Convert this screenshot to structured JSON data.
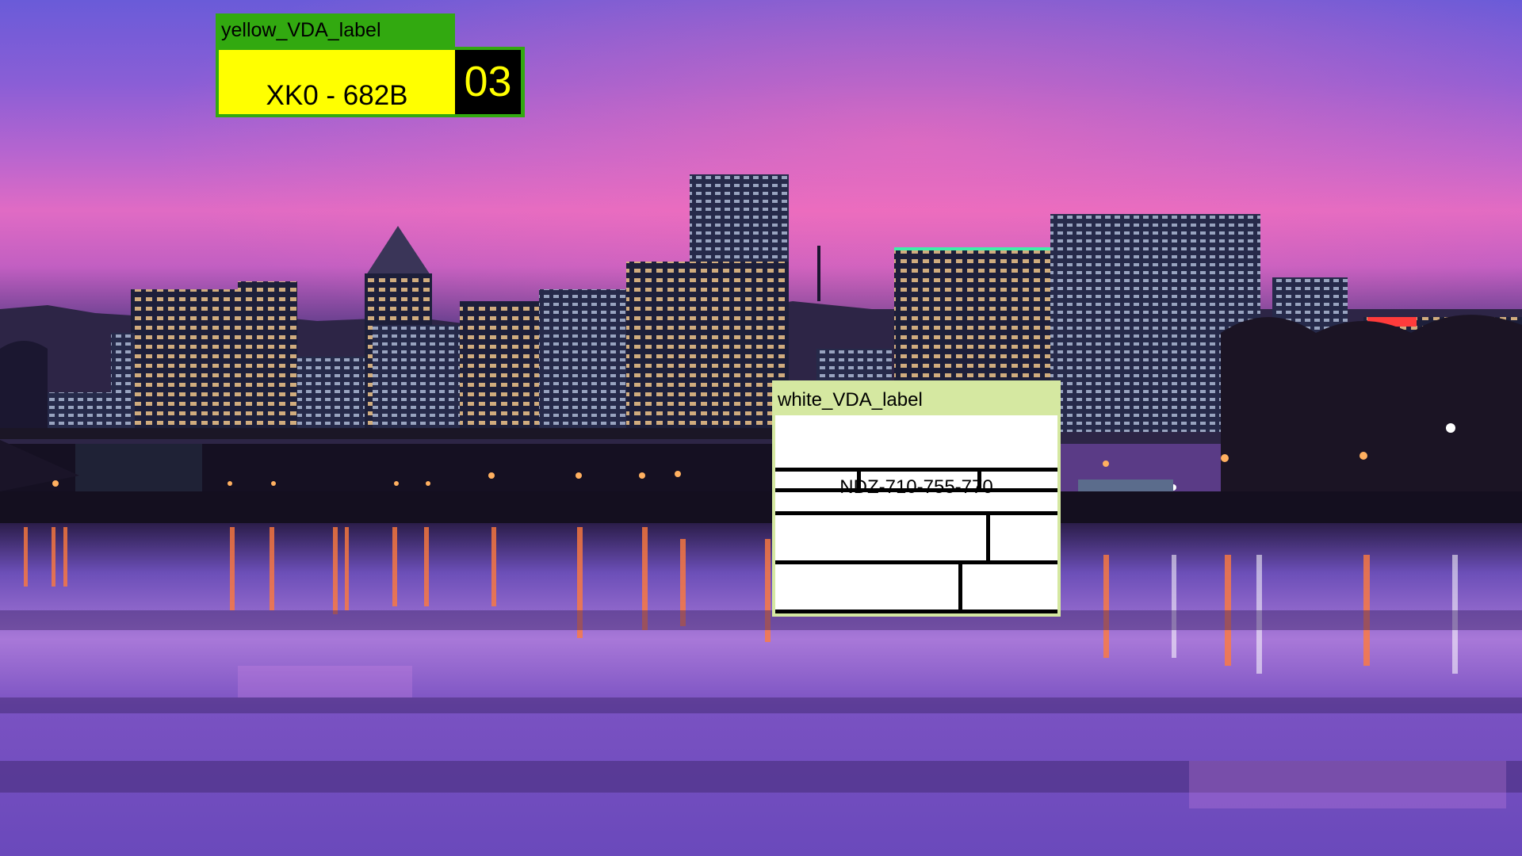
{
  "yellow_label": {
    "title": "yellow_VDA_label",
    "plate": "XK0 - 682B",
    "number": "03"
  },
  "white_label": {
    "title": "white_VDA_label",
    "code": "NDZ-710-755-770"
  },
  "colors": {
    "label_green": "#32a910",
    "plate_yellow": "#ffff00",
    "number_box": "#000000",
    "white_label_frame": "#d5e8a1",
    "sky_top": "#6d5fd6",
    "sky_pink": "#e064c4",
    "water": "#7a4cc0"
  }
}
